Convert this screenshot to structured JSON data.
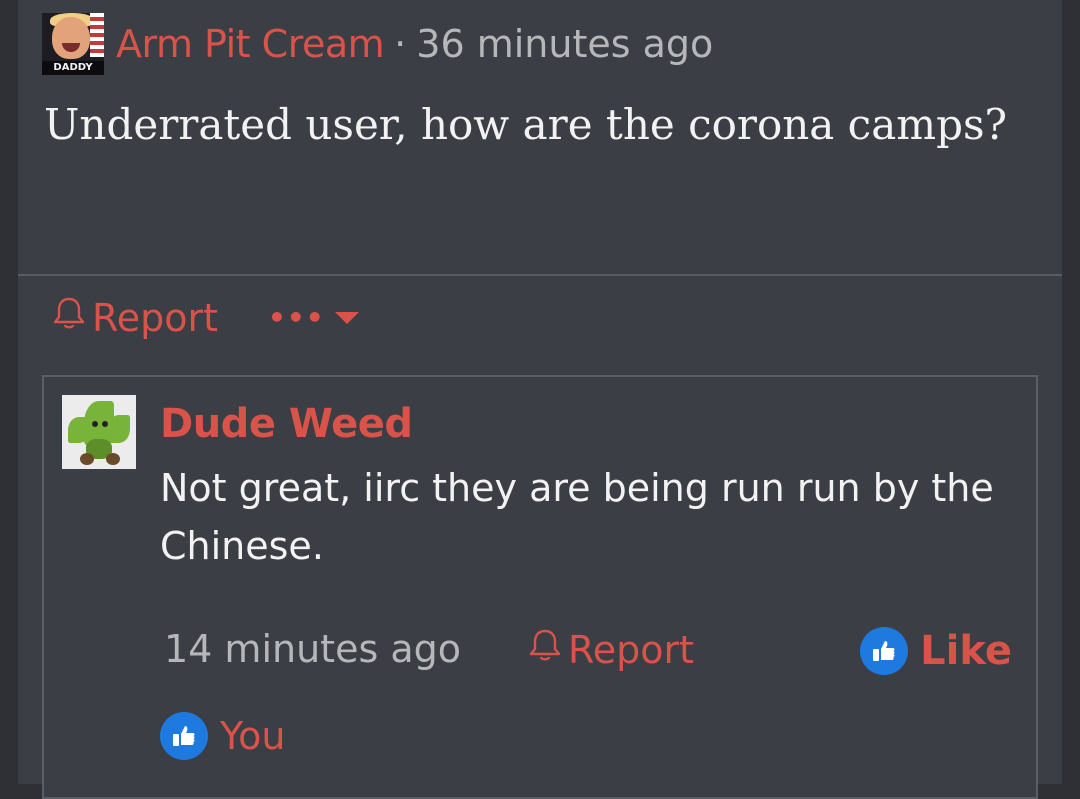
{
  "post": {
    "avatar_tag": "DADDY",
    "author": "Arm Pit Cream",
    "separator": "·",
    "time": "36 minutes ago",
    "body": "Underrated user, how are the corona camps?",
    "report_label": "Report",
    "more_label": "•••"
  },
  "reply": {
    "author": "Dude Weed",
    "body": "Not great, iirc they are being run run by the Chinese.",
    "time": "14 minutes ago",
    "report_label": "Report",
    "like_label": "Like",
    "liked_by": "You"
  },
  "colors": {
    "accent": "#d9534a",
    "background": "#3b3e44",
    "text": "#f2f2f2",
    "muted": "#b6b7ba",
    "like_blue": "#1f7ae0"
  },
  "icons": {
    "report": "bell-icon",
    "more": "ellipsis-icon",
    "dropdown": "caret-down-icon",
    "like": "thumbs-up-icon"
  }
}
